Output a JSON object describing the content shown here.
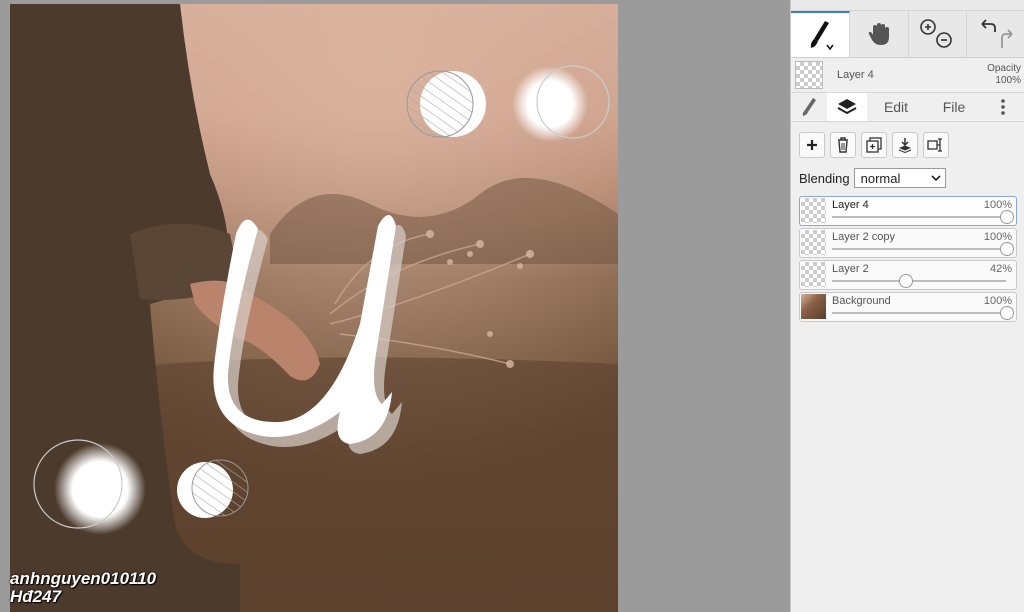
{
  "watermark": {
    "line1": "anhnguyen010110",
    "line2": "Hđ247"
  },
  "toolbar": {
    "tools": [
      {
        "name": "brush-icon",
        "active": true
      },
      {
        "name": "hand-icon",
        "active": false
      },
      {
        "name": "zoom-icon",
        "active": false
      },
      {
        "name": "undo-redo-icon",
        "active": false
      }
    ]
  },
  "current_layer": {
    "name": "Layer 4",
    "opacity_label": "Opacity",
    "opacity_value": "100%"
  },
  "tabs": {
    "edit": "Edit",
    "file": "File"
  },
  "blending": {
    "label": "Blending",
    "value": "normal"
  },
  "layers": [
    {
      "name": "Layer 4",
      "percent": "100%",
      "level": 1.0,
      "selected": true
    },
    {
      "name": "Layer 2 copy",
      "percent": "100%",
      "level": 1.0,
      "selected": false
    },
    {
      "name": "Layer 2",
      "percent": "42%",
      "level": 0.42,
      "selected": false
    },
    {
      "name": "Background",
      "percent": "100%",
      "level": 1.0,
      "selected": false
    }
  ],
  "colors": {
    "accent": "#3f7fd3",
    "panel": "#efefef",
    "workspace": "#9b9b9b"
  }
}
